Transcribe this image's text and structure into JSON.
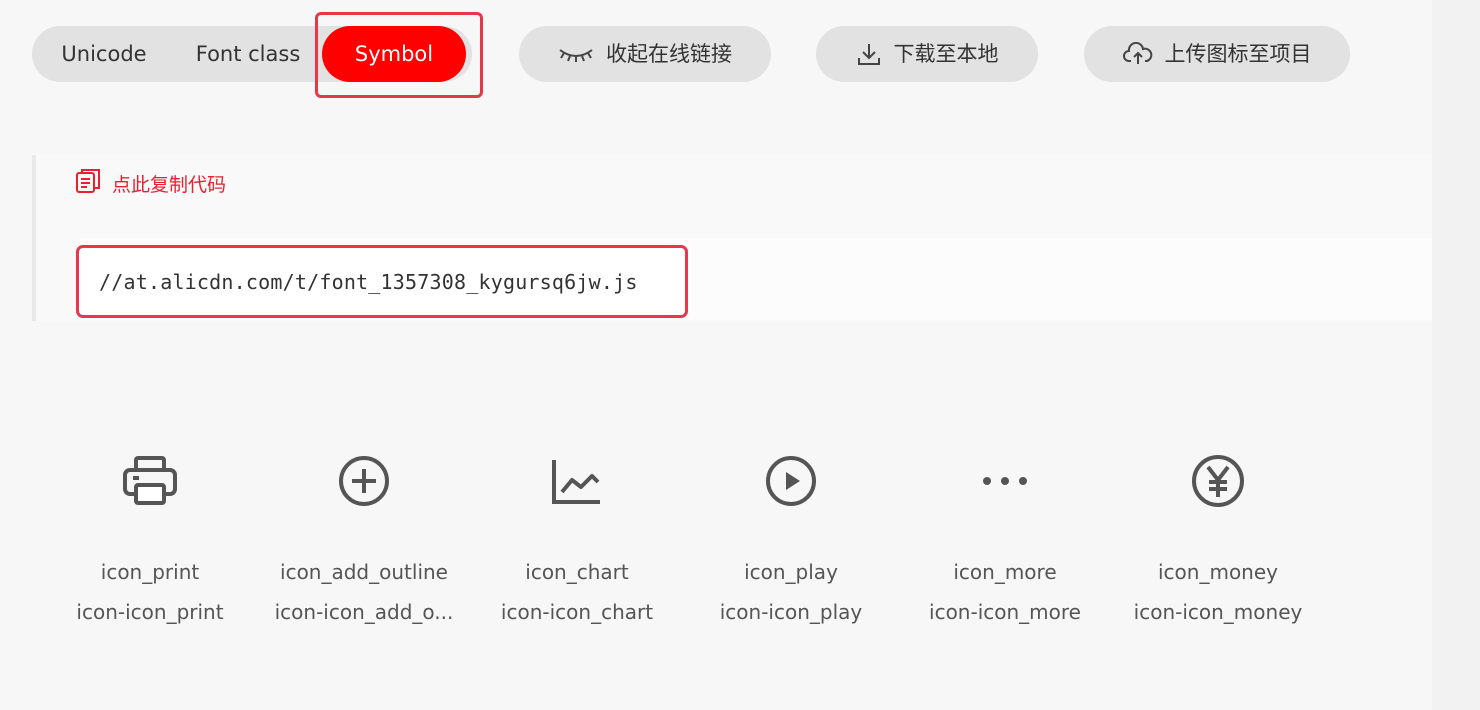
{
  "tabs": [
    {
      "label": "Unicode"
    },
    {
      "label": "Font class"
    },
    {
      "label": "Symbol",
      "active": true
    }
  ],
  "toolbar": {
    "collapse_label": "收起在线链接",
    "download_label": "下载至本地",
    "upload_label": "上传图标至项目"
  },
  "code_section": {
    "copy_label": "点此复制代码",
    "url": "//at.alicdn.com/t/font_1357308_kygursq6jw.js"
  },
  "icons": [
    {
      "name": "icon_print",
      "code": "icon-icon_print",
      "icon": "print-icon"
    },
    {
      "name": "icon_add_outline",
      "code": "icon-icon_add_o...",
      "icon": "add-outline-icon"
    },
    {
      "name": "icon_chart",
      "code": "icon-icon_chart",
      "icon": "chart-icon"
    },
    {
      "name": "icon_play",
      "code": "icon-icon_play",
      "icon": "play-icon"
    },
    {
      "name": "icon_more",
      "code": "icon-icon_more",
      "icon": "more-icon"
    },
    {
      "name": "icon_money",
      "code": "icon-icon_money",
      "icon": "money-icon"
    }
  ],
  "colors": {
    "accent": "#ff0000",
    "highlight_border": "#e8374a",
    "copy_text": "#e8202f",
    "pill_bg": "#e2e2e2"
  }
}
